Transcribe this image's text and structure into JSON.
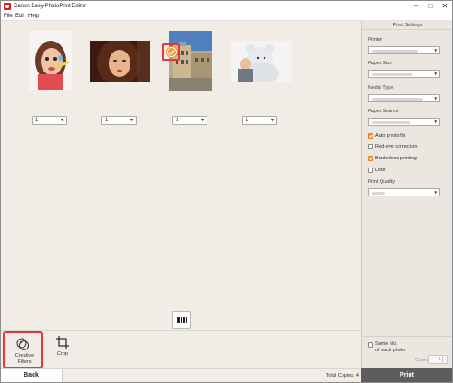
{
  "window": {
    "title": "Canon Easy-PhotoPrint Editor",
    "minimize_glyph": "–",
    "maximize_glyph": "□",
    "close_glyph": "✕"
  },
  "menu": [
    "File",
    "Edit",
    "Help"
  ],
  "photos": [
    {
      "copies": "1"
    },
    {
      "copies": "1"
    },
    {
      "copies": "1",
      "selected": true
    },
    {
      "copies": "1"
    }
  ],
  "tools": {
    "creative_filters": "Creative\nFilters",
    "crop": "Crop"
  },
  "bottom": {
    "back": "Back",
    "total_copies": "Total Copies: 4"
  },
  "settings": {
    "title": "Print Settings",
    "printer_label": "Printer",
    "paper_size_label": "Paper Size",
    "media_type_label": "Media Type",
    "paper_source_label": "Paper Source",
    "print_quality_label": "Print Quality",
    "checkboxes": [
      {
        "label": "Auto photo fix",
        "checked": true
      },
      {
        "label": "Red-eye correction",
        "checked": false
      },
      {
        "label": "Borderless printing",
        "checked": true
      },
      {
        "label": "Date",
        "checked": false
      }
    ]
  },
  "copies_panel": {
    "same_no_label": "Same No.\nof each photo",
    "copies_label": "Copies",
    "copies_value": "1",
    "same_no_checked": false
  },
  "print_button": "Print",
  "colors": {
    "accent": "#f39a33",
    "highlight": "#e23a3a",
    "print_button": "#5d5d5d",
    "background": "#f1ede6"
  }
}
